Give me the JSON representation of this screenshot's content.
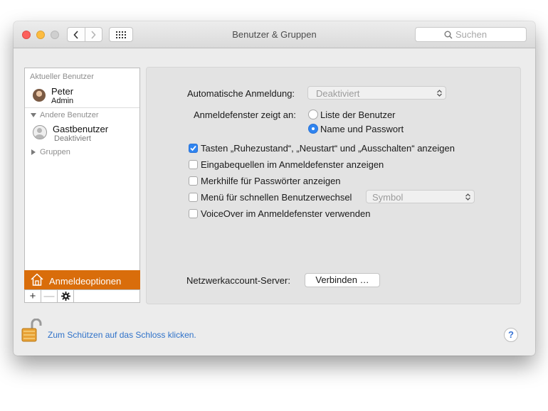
{
  "window": {
    "title": "Benutzer & Gruppen",
    "search_placeholder": "Suchen"
  },
  "sidebar": {
    "current_header": "Aktueller Benutzer",
    "current_user": {
      "name": "Peter",
      "role": "Admin"
    },
    "others_header": "Andere Benutzer",
    "guest": {
      "name": "Gastbenutzer",
      "status": "Deaktiviert"
    },
    "groups_label": "Gruppen",
    "login_options_label": "Anmeldeoptionen",
    "add_symbol": "+",
    "remove_symbol": "—"
  },
  "main": {
    "auto_login_label": "Automatische Anmeldung:",
    "auto_login_value": "Deaktiviert",
    "display_label": "Anmeldefenster zeigt an:",
    "radio_list_label": "Liste der Benutzer",
    "radio_name_label": "Name und Passwort",
    "radio_selected": "Name und Passwort",
    "checkboxes": [
      {
        "label": "Tasten „Ruhezustand“, „Neustart“ und „Ausschalten“ anzeigen",
        "checked": true
      },
      {
        "label": "Eingabequellen im Anmeldefenster anzeigen",
        "checked": false
      },
      {
        "label": "Merkhilfe für Passwörter anzeigen",
        "checked": false
      },
      {
        "label": "Menü für schnellen Benutzerwechsel",
        "checked": false
      },
      {
        "label": "VoiceOver im Anmeldefenster verwenden",
        "checked": false
      }
    ],
    "fast_switch_value": "Symbol",
    "network_label": "Netzwerkaccount-Server:",
    "connect_button": "Verbinden …"
  },
  "footer": {
    "lock_text": "Zum Schützen auf das Schloss klicken.",
    "help_label": "?"
  },
  "colors": {
    "accent": "#2f84f0",
    "selection": "#d96d0b",
    "link": "#2f72c9"
  }
}
